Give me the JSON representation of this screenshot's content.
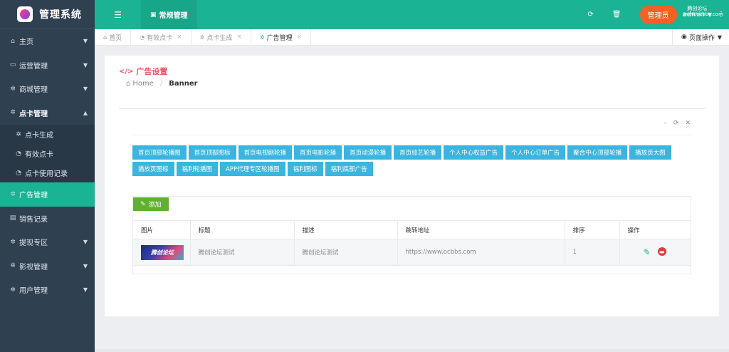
{
  "brand": {
    "title": "管理系统"
  },
  "sidebar": {
    "items": [
      {
        "label": "主页",
        "icon": "home-icon"
      },
      {
        "label": "运营管理",
        "icon": "window-icon"
      },
      {
        "label": "商城管理",
        "icon": "gears-icon"
      },
      {
        "label": "点卡管理",
        "icon": "gears-icon"
      },
      {
        "label": "广告管理",
        "icon": "gears-icon"
      },
      {
        "label": "销售记录",
        "icon": "file-icon"
      },
      {
        "label": "提现专区",
        "icon": "gears-icon"
      },
      {
        "label": "影视管理",
        "icon": "gears-icon"
      },
      {
        "label": "用户管理",
        "icon": "gears-icon"
      }
    ],
    "sub_items": [
      {
        "label": "点卡生成",
        "icon": "gears-icon"
      },
      {
        "label": "有效点卡",
        "icon": "dashboard-icon"
      },
      {
        "label": "点卡使用记录",
        "icon": "dashboard-icon"
      }
    ]
  },
  "topbar": {
    "active_tab": "常规管理",
    "role": "管理员",
    "user": "admin",
    "watermark_line1": "腾创论坛",
    "watermark_line2": "www.ocbbs.com"
  },
  "tabs": [
    {
      "label": "首页",
      "closable": false
    },
    {
      "label": "有效点卡",
      "closable": true
    },
    {
      "label": "点卡生成",
      "closable": true
    },
    {
      "label": "广告管理",
      "closable": true
    }
  ],
  "page_ops": "页面操作",
  "panel": {
    "title": "广告设置",
    "breadcrumb_home": "Home",
    "breadcrumb_current": "Banner"
  },
  "categories": [
    "首页顶部轮播图",
    "首页顶部图标",
    "首页电视剧轮播",
    "首页电影轮播",
    "首页动漫轮播",
    "首页综艺轮播",
    "个人中心权益广告",
    "个人中心订单广告",
    "聚合中心顶部轮播",
    "播放页大图",
    "播放页图标",
    "福利轮播图",
    "APP代理专区轮播图",
    "福利图标",
    "福利底部广告"
  ],
  "add_label": "添加",
  "table": {
    "headers": [
      "图片",
      "标题",
      "描述",
      "跳转地址",
      "排序",
      "操作"
    ],
    "rows": [
      {
        "thumb_text": "腾创论坛",
        "title": "腾创论坛测试",
        "desc": "腾创论坛测试",
        "url": "https://www.ocbbs.com",
        "sort": "1"
      }
    ]
  }
}
